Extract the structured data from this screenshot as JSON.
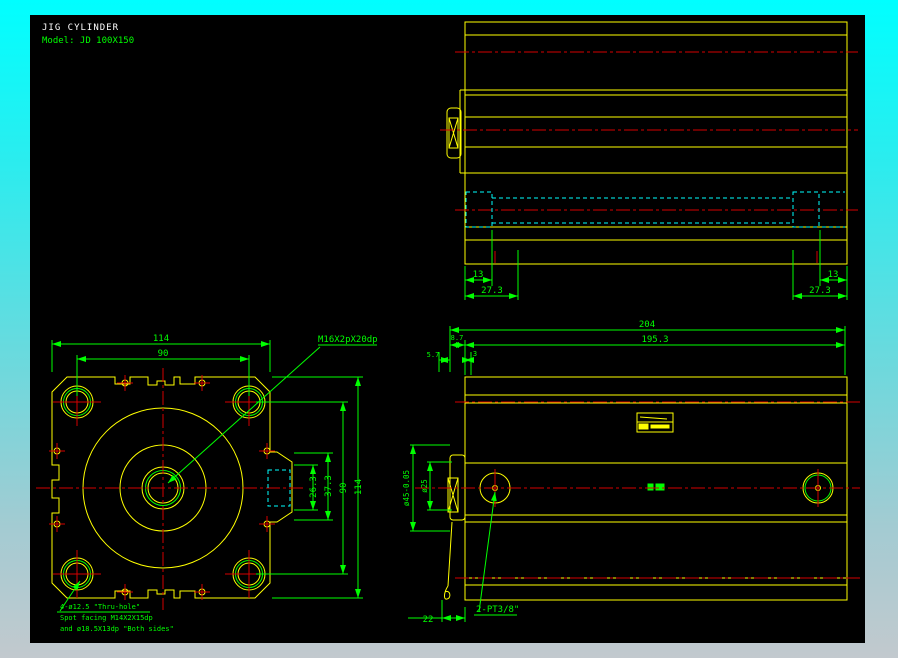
{
  "title_block": {
    "title": "JIG CYLINDER",
    "model": "Model: JD 100X150"
  },
  "colors": {
    "background": "#000000",
    "border_top": "#00ffff",
    "border_bottom": "#c2c9ce",
    "outline": "#ffff00",
    "dimension": "#00ff00",
    "centerline": "#d40000",
    "hidden": "#00ffff",
    "title_text": "#ffffff"
  },
  "top_view": {
    "dim_13_left": "13",
    "dim_273_left": "27.3",
    "dim_13_right": "13",
    "dim_273_right": "27.3"
  },
  "front_view": {
    "dim_width": "114",
    "dim_bolt_spacing": "90",
    "dim_port_inner": "26.3",
    "dim_port_outer": "37.3",
    "dim_bolt_spacing_v": "90",
    "dim_height": "114",
    "thread_label": "M16X2pX20dp",
    "note_line1": "4-ø12.5 \"Thru-hole\"",
    "note_line2": "Spot facing M14X2X15dp",
    "note_line3": "and ø18.5X13dp \"Both sides\""
  },
  "side_view": {
    "dim_overall": "204",
    "dim_body": "195.3",
    "dim_cap": "8.7",
    "dim_rod_ext": "5.7",
    "dim_step": "3",
    "dim_rod_od": "ø45-0.05",
    "dim_rod_id": "ø25",
    "dim_port_offset": "22",
    "port_label": "2-PT3/8\""
  }
}
